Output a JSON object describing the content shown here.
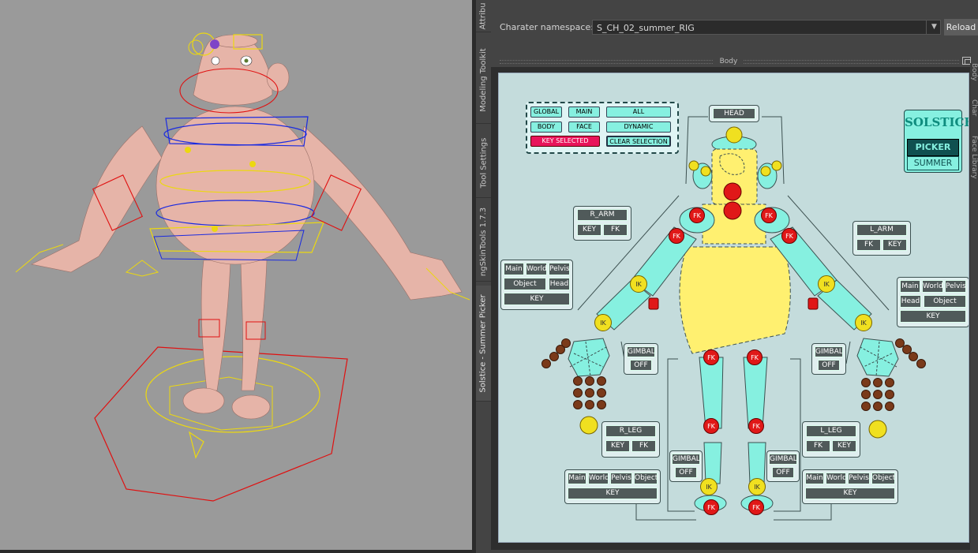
{
  "side_tabs": [
    {
      "label": "Attribu",
      "active": false
    },
    {
      "label": "Modeling Toolkit",
      "active": false
    },
    {
      "label": "Tool Settings",
      "active": false
    },
    {
      "label": "ngSkinTools 1.7.3",
      "active": false
    },
    {
      "label": "Solstice - Summer Picker",
      "active": true
    }
  ],
  "namespace": {
    "label": "Charater namespace:",
    "value": "S_CH_02_summer_RIG"
  },
  "reload_label": "Reload",
  "body_section_title": "Body",
  "right_tabs": [
    "Body",
    "Char",
    "Face Library"
  ],
  "picker": {
    "logo_title": "SOLSTICE",
    "logo_subtitle": "PICKER",
    "logo_character": "SUMMER",
    "global_grid": [
      "GLOBAL",
      "MAIN",
      "ALL",
      "BODY",
      "FACE",
      "DYNAMIC",
      "KEY SELECTED",
      "CLEAR SELECTION"
    ],
    "head_label": "HEAD",
    "r_arm": {
      "title": "R_ARM",
      "key": "KEY",
      "fk": "FK"
    },
    "l_arm": {
      "title": "L_ARM",
      "fk": "FK",
      "key": "KEY"
    },
    "r_space": {
      "main": "Main",
      "world": "World",
      "pelvis": "Pelvis",
      "object": "Object",
      "head": "Head",
      "key": "KEY"
    },
    "l_space": {
      "main": "Main",
      "world": "World",
      "pelvis": "Pelvis",
      "head": "Head",
      "object": "Object",
      "key": "KEY"
    },
    "gimbal_label": "GIMBAL",
    "off_label": "OFF",
    "r_leg": {
      "title": "R_LEG",
      "key": "KEY",
      "fk": "FK"
    },
    "l_leg": {
      "title": "L_LEG",
      "fk": "FK",
      "key": "KEY"
    },
    "r_leg_space": {
      "main": "Main",
      "world": "World",
      "pelvis": "Pelvis",
      "object": "Object",
      "key": "KEY"
    },
    "l_leg_space": {
      "main": "Main",
      "world": "World",
      "pelvis": "Pelvis",
      "object": "Object",
      "key": "KEY"
    },
    "fk_label": "FK",
    "ik_label": "IK"
  },
  "colors": {
    "picker_bg": "#c4dcdc",
    "cyan": "#86f0e0",
    "yellow": "#fff070",
    "red": "#e01818",
    "brown": "#7a3a1a",
    "key_selected": "#e8145a"
  }
}
